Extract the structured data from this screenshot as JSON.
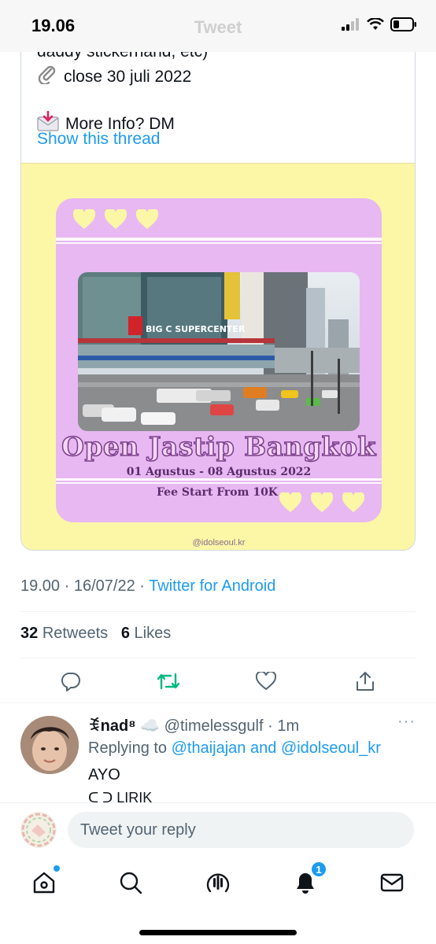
{
  "status_bar": {
    "time": "19.06",
    "ghost_title": "Tweet"
  },
  "tweet": {
    "text_lines": [
      "daddy stickerhand, etc)",
      "close 30 juli 2022",
      "",
      "More Info? DM"
    ],
    "show_thread": "Show this thread",
    "media": {
      "title": "Open Jastip Bangkok",
      "dates": "01 Agustus - 08 Agustus 2022",
      "fee": "Fee Start From 10K",
      "storefront_sign": "BIG C SUPERCENTER",
      "watermark": "@idolseoul.kr"
    },
    "meta": {
      "time": "19.00",
      "date": "16/07/22",
      "separator": "·",
      "source": "Twitter for Android"
    },
    "counts": {
      "retweets": "32",
      "retweets_label": "Retweets",
      "likes": "6",
      "likes_label": "Likes"
    }
  },
  "reply": {
    "name": "ꉂnad⁸ ☁️",
    "handle": "@timelessgulf",
    "time": "1m",
    "separator": "·",
    "more": "···",
    "replying_prefix": "Replying to",
    "replying_to_1": "@thaijajan",
    "replying_and": "and",
    "replying_to_2": "@idolseoul_kr",
    "body": "AYO",
    "cut_line": "ᑕ ᑐ        LIRIK"
  },
  "composer": {
    "placeholder": "Tweet your reply"
  },
  "tab_bar": {
    "notifications_badge": "1"
  },
  "colors": {
    "accent": "#1d9bf0",
    "retweet_green": "#00ba7c",
    "media_bg": "#fbf7a7",
    "promo_bg": "#e7b8f2",
    "hearts": "#fbf7a7"
  }
}
